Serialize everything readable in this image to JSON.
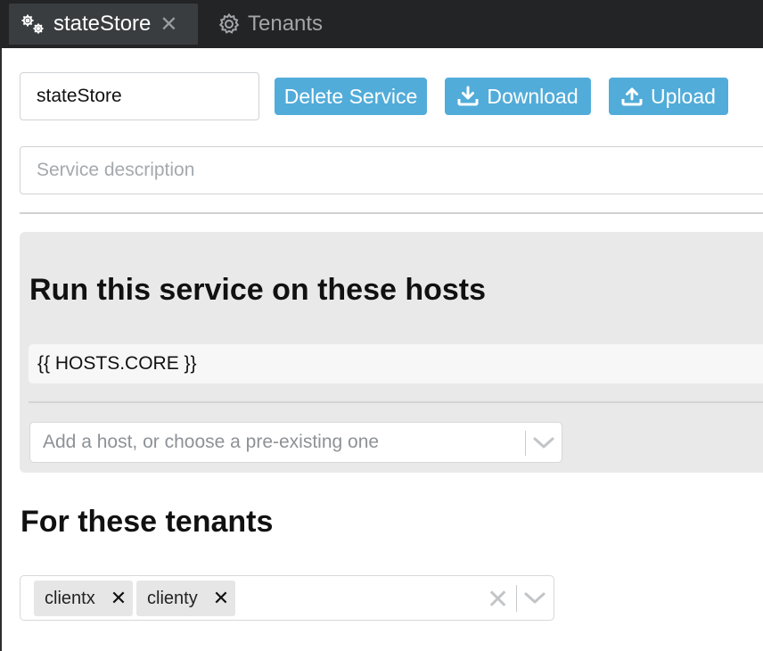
{
  "tabs": [
    {
      "label": "stateStore",
      "icon": "gears-icon",
      "active": true,
      "close_glyph": "✕"
    },
    {
      "label": "Tenants",
      "icon": "gear-icon",
      "active": false
    }
  ],
  "service": {
    "name": "stateStore",
    "description_placeholder": "Service description",
    "buttons": {
      "delete": "Delete Service",
      "download": "Download",
      "upload": "Upload"
    }
  },
  "hosts": {
    "title": "Run this service on these hosts",
    "items": [
      "{{ HOSTS.CORE }}"
    ],
    "add_placeholder": "Add a host, or choose a pre-existing one"
  },
  "tenants": {
    "title": "For these tenants",
    "selected": [
      {
        "label": "clientx",
        "remove_glyph": "✕"
      },
      {
        "label": "clienty",
        "remove_glyph": "✕"
      }
    ],
    "clear_glyph": "✕"
  },
  "colors": {
    "tabbar_bg": "#222426",
    "active_tab_bg": "#3a3d40",
    "button_accent": "#52acd9",
    "panel_bg": "#e9e9e9",
    "chip_bg": "#e6e6e6"
  }
}
